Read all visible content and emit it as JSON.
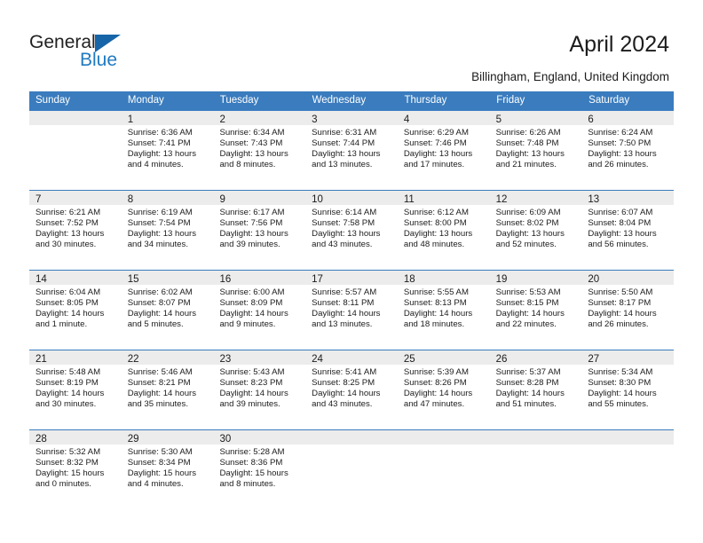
{
  "brand": {
    "name_part1": "General",
    "name_part2": "Blue",
    "triangle_color": "#1565a8",
    "blue_color": "#1f7ac0"
  },
  "header": {
    "title": "April 2024",
    "subtitle": "Billingham, England, United Kingdom"
  },
  "calendar": {
    "header_bg": "#3a7cbe",
    "day_band_bg": "#ececec",
    "weekdays": [
      "Sunday",
      "Monday",
      "Tuesday",
      "Wednesday",
      "Thursday",
      "Friday",
      "Saturday"
    ],
    "labels": {
      "sunrise": "Sunrise:",
      "sunset": "Sunset:",
      "daylight": "Daylight:"
    },
    "weeks": [
      [
        {
          "day": "",
          "empty": true
        },
        {
          "day": "1",
          "sunrise": "Sunrise: 6:36 AM",
          "sunset": "Sunset: 7:41 PM",
          "daylight1": "Daylight: 13 hours",
          "daylight2": "and 4 minutes."
        },
        {
          "day": "2",
          "sunrise": "Sunrise: 6:34 AM",
          "sunset": "Sunset: 7:43 PM",
          "daylight1": "Daylight: 13 hours",
          "daylight2": "and 8 minutes."
        },
        {
          "day": "3",
          "sunrise": "Sunrise: 6:31 AM",
          "sunset": "Sunset: 7:44 PM",
          "daylight1": "Daylight: 13 hours",
          "daylight2": "and 13 minutes."
        },
        {
          "day": "4",
          "sunrise": "Sunrise: 6:29 AM",
          "sunset": "Sunset: 7:46 PM",
          "daylight1": "Daylight: 13 hours",
          "daylight2": "and 17 minutes."
        },
        {
          "day": "5",
          "sunrise": "Sunrise: 6:26 AM",
          "sunset": "Sunset: 7:48 PM",
          "daylight1": "Daylight: 13 hours",
          "daylight2": "and 21 minutes."
        },
        {
          "day": "6",
          "sunrise": "Sunrise: 6:24 AM",
          "sunset": "Sunset: 7:50 PM",
          "daylight1": "Daylight: 13 hours",
          "daylight2": "and 26 minutes."
        }
      ],
      [
        {
          "day": "7",
          "sunrise": "Sunrise: 6:21 AM",
          "sunset": "Sunset: 7:52 PM",
          "daylight1": "Daylight: 13 hours",
          "daylight2": "and 30 minutes."
        },
        {
          "day": "8",
          "sunrise": "Sunrise: 6:19 AM",
          "sunset": "Sunset: 7:54 PM",
          "daylight1": "Daylight: 13 hours",
          "daylight2": "and 34 minutes."
        },
        {
          "day": "9",
          "sunrise": "Sunrise: 6:17 AM",
          "sunset": "Sunset: 7:56 PM",
          "daylight1": "Daylight: 13 hours",
          "daylight2": "and 39 minutes."
        },
        {
          "day": "10",
          "sunrise": "Sunrise: 6:14 AM",
          "sunset": "Sunset: 7:58 PM",
          "daylight1": "Daylight: 13 hours",
          "daylight2": "and 43 minutes."
        },
        {
          "day": "11",
          "sunrise": "Sunrise: 6:12 AM",
          "sunset": "Sunset: 8:00 PM",
          "daylight1": "Daylight: 13 hours",
          "daylight2": "and 48 minutes."
        },
        {
          "day": "12",
          "sunrise": "Sunrise: 6:09 AM",
          "sunset": "Sunset: 8:02 PM",
          "daylight1": "Daylight: 13 hours",
          "daylight2": "and 52 minutes."
        },
        {
          "day": "13",
          "sunrise": "Sunrise: 6:07 AM",
          "sunset": "Sunset: 8:04 PM",
          "daylight1": "Daylight: 13 hours",
          "daylight2": "and 56 minutes."
        }
      ],
      [
        {
          "day": "14",
          "sunrise": "Sunrise: 6:04 AM",
          "sunset": "Sunset: 8:05 PM",
          "daylight1": "Daylight: 14 hours",
          "daylight2": "and 1 minute."
        },
        {
          "day": "15",
          "sunrise": "Sunrise: 6:02 AM",
          "sunset": "Sunset: 8:07 PM",
          "daylight1": "Daylight: 14 hours",
          "daylight2": "and 5 minutes."
        },
        {
          "day": "16",
          "sunrise": "Sunrise: 6:00 AM",
          "sunset": "Sunset: 8:09 PM",
          "daylight1": "Daylight: 14 hours",
          "daylight2": "and 9 minutes."
        },
        {
          "day": "17",
          "sunrise": "Sunrise: 5:57 AM",
          "sunset": "Sunset: 8:11 PM",
          "daylight1": "Daylight: 14 hours",
          "daylight2": "and 13 minutes."
        },
        {
          "day": "18",
          "sunrise": "Sunrise: 5:55 AM",
          "sunset": "Sunset: 8:13 PM",
          "daylight1": "Daylight: 14 hours",
          "daylight2": "and 18 minutes."
        },
        {
          "day": "19",
          "sunrise": "Sunrise: 5:53 AM",
          "sunset": "Sunset: 8:15 PM",
          "daylight1": "Daylight: 14 hours",
          "daylight2": "and 22 minutes."
        },
        {
          "day": "20",
          "sunrise": "Sunrise: 5:50 AM",
          "sunset": "Sunset: 8:17 PM",
          "daylight1": "Daylight: 14 hours",
          "daylight2": "and 26 minutes."
        }
      ],
      [
        {
          "day": "21",
          "sunrise": "Sunrise: 5:48 AM",
          "sunset": "Sunset: 8:19 PM",
          "daylight1": "Daylight: 14 hours",
          "daylight2": "and 30 minutes."
        },
        {
          "day": "22",
          "sunrise": "Sunrise: 5:46 AM",
          "sunset": "Sunset: 8:21 PM",
          "daylight1": "Daylight: 14 hours",
          "daylight2": "and 35 minutes."
        },
        {
          "day": "23",
          "sunrise": "Sunrise: 5:43 AM",
          "sunset": "Sunset: 8:23 PM",
          "daylight1": "Daylight: 14 hours",
          "daylight2": "and 39 minutes."
        },
        {
          "day": "24",
          "sunrise": "Sunrise: 5:41 AM",
          "sunset": "Sunset: 8:25 PM",
          "daylight1": "Daylight: 14 hours",
          "daylight2": "and 43 minutes."
        },
        {
          "day": "25",
          "sunrise": "Sunrise: 5:39 AM",
          "sunset": "Sunset: 8:26 PM",
          "daylight1": "Daylight: 14 hours",
          "daylight2": "and 47 minutes."
        },
        {
          "day": "26",
          "sunrise": "Sunrise: 5:37 AM",
          "sunset": "Sunset: 8:28 PM",
          "daylight1": "Daylight: 14 hours",
          "daylight2": "and 51 minutes."
        },
        {
          "day": "27",
          "sunrise": "Sunrise: 5:34 AM",
          "sunset": "Sunset: 8:30 PM",
          "daylight1": "Daylight: 14 hours",
          "daylight2": "and 55 minutes."
        }
      ],
      [
        {
          "day": "28",
          "sunrise": "Sunrise: 5:32 AM",
          "sunset": "Sunset: 8:32 PM",
          "daylight1": "Daylight: 15 hours",
          "daylight2": "and 0 minutes."
        },
        {
          "day": "29",
          "sunrise": "Sunrise: 5:30 AM",
          "sunset": "Sunset: 8:34 PM",
          "daylight1": "Daylight: 15 hours",
          "daylight2": "and 4 minutes."
        },
        {
          "day": "30",
          "sunrise": "Sunrise: 5:28 AM",
          "sunset": "Sunset: 8:36 PM",
          "daylight1": "Daylight: 15 hours",
          "daylight2": "and 8 minutes."
        },
        {
          "day": "",
          "empty": true
        },
        {
          "day": "",
          "empty": true
        },
        {
          "day": "",
          "empty": true
        },
        {
          "day": "",
          "empty": true
        }
      ]
    ]
  }
}
